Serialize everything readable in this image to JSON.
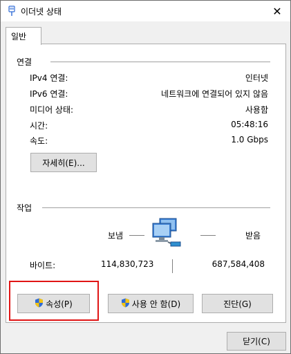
{
  "window": {
    "title": "이더넷 상태",
    "icon": "ethernet-icon",
    "close_glyph": "✕"
  },
  "tabs": [
    {
      "label": "일반"
    }
  ],
  "connection": {
    "section_label": "연결",
    "rows": [
      {
        "label": "IPv4 연결:",
        "value": "인터넷"
      },
      {
        "label": "IPv6 연결:",
        "value": "네트워크에 연결되어 있지 않음"
      },
      {
        "label": "미디어 상태:",
        "value": "사용함"
      },
      {
        "label": "시간:",
        "value": "05:48:16"
      },
      {
        "label": "속도:",
        "value": "1.0 Gbps"
      }
    ],
    "details_button": "자세히(E)..."
  },
  "activity": {
    "section_label": "작업",
    "sent_label": "보냄",
    "received_label": "받음",
    "bytes_label": "바이트:",
    "sent_bytes": "114,830,723",
    "received_bytes": "687,584,408",
    "icon": "network-computers-icon"
  },
  "actions": {
    "properties": "속성(P)",
    "disable": "사용 안 함(D)",
    "diagnose": "진단(G)"
  },
  "footer": {
    "close_button": "닫기(C)"
  },
  "colors": {
    "highlight": "#e01414",
    "button_bg": "#e1e1e1",
    "shield_blue": "#2f6bd6",
    "shield_yellow": "#f2c314"
  }
}
